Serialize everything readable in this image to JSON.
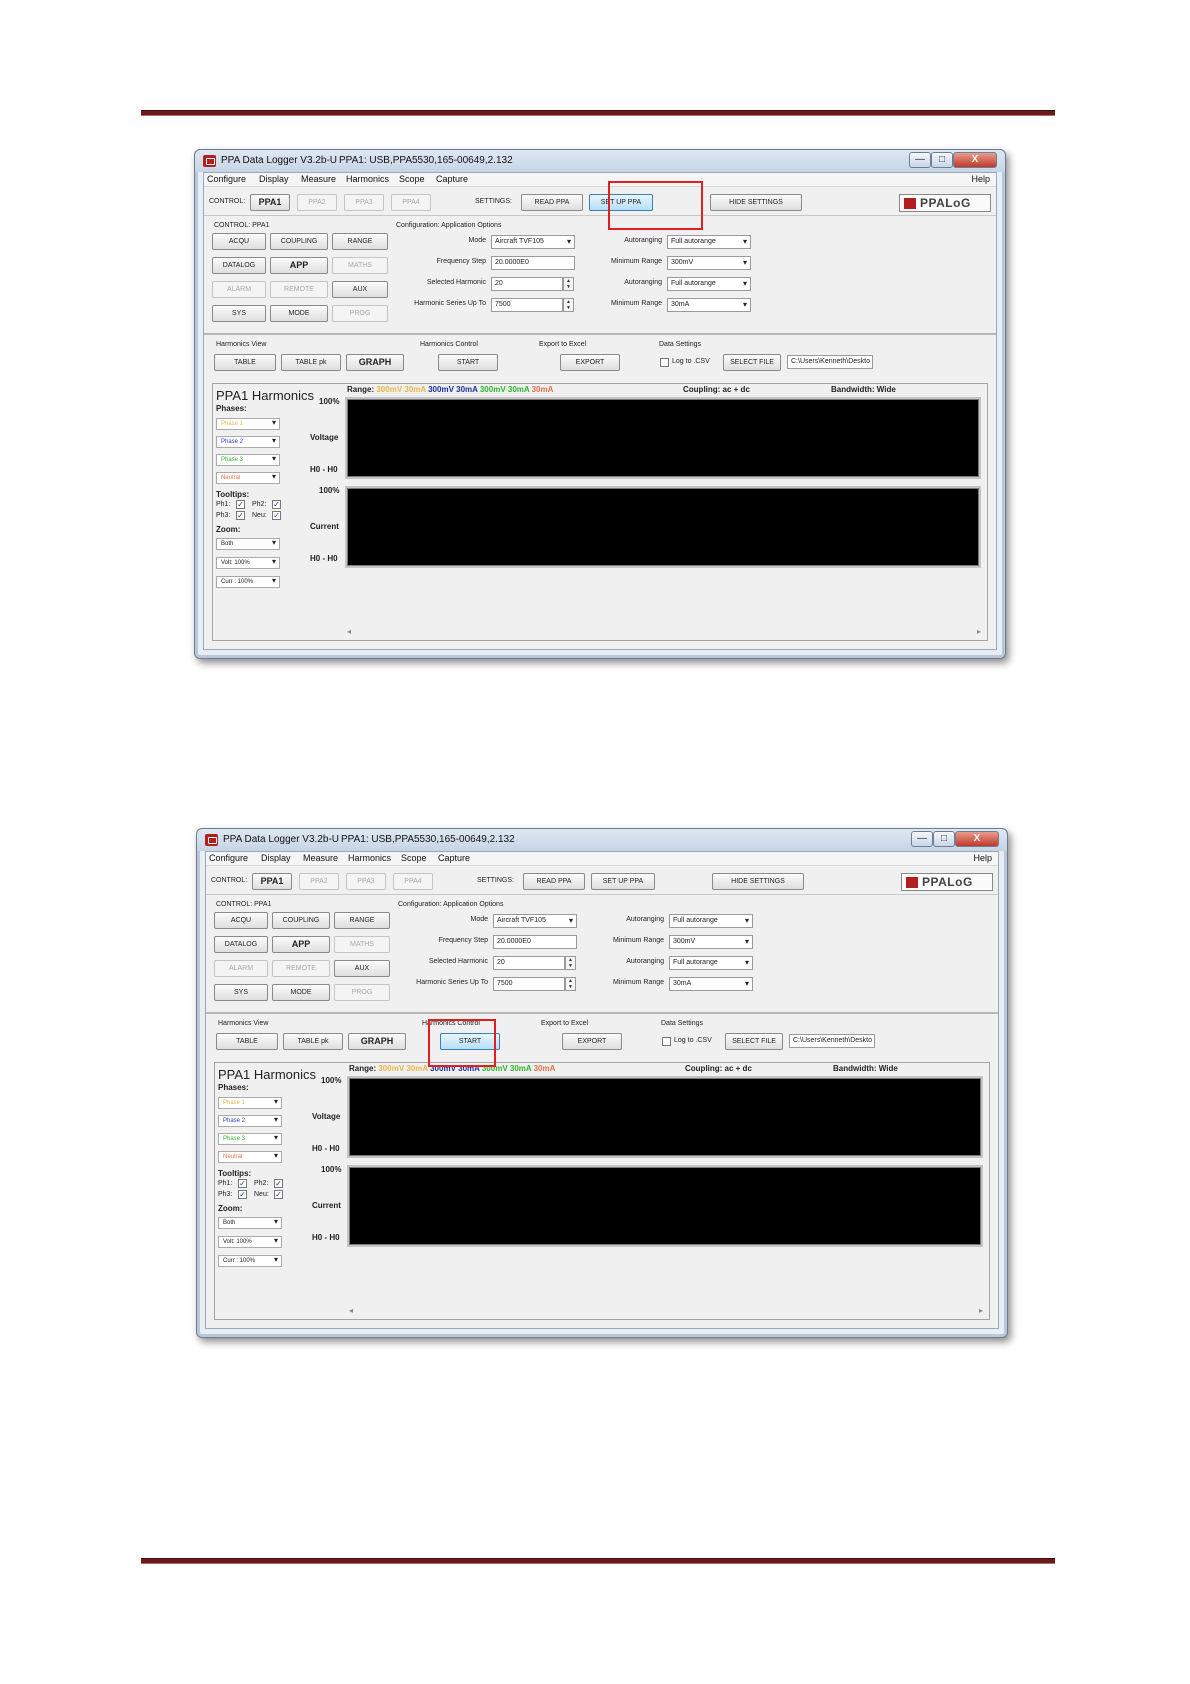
{
  "app": {
    "title": "PPA Data Logger V3.2b-U",
    "connection": "PPA1: USB,PPA5530,165-00649,2.132",
    "window_buttons": {
      "minimize": "—",
      "maximize": "□",
      "close": "X"
    }
  },
  "menu": [
    "Configure",
    "Display",
    "Measure",
    "Harmonics",
    "Scope",
    "Capture"
  ],
  "menu_help": "Help",
  "control_bar": {
    "control_label": "CONTROL:",
    "ppa_tabs": [
      "PPA1",
      "PPA2",
      "PPA3",
      "PPA4"
    ],
    "settings_label": "SETTINGS:",
    "read_ppa": "READ PPA",
    "set_up_ppa": "SET UP PPA",
    "hide_settings": "HIDE SETTINGS",
    "logo": "PPALoG"
  },
  "settings": {
    "control_title": "CONTROL: PPA1",
    "buttons": [
      "ACQU",
      "COUPLING",
      "RANGE",
      "DATALOG",
      "APP",
      "MATHS",
      "ALARM",
      "REMOTE",
      "AUX",
      "SYS",
      "MODE",
      "PROG"
    ],
    "config_title": "Configuration: Application Options",
    "fields": {
      "mode_label": "Mode",
      "mode_value": "Aircraft TVF105",
      "freq_label": "Frequency Step",
      "freq_value": "20.0000E0",
      "sel_label": "Selected Harmonic",
      "sel_value": "20",
      "series_label": "Harmonic Series Up To",
      "series_value": "7500",
      "auto1_label": "Autoranging",
      "auto1_value": "Full autorange",
      "min1_label": "Minimum Range",
      "min1_value": "300mV",
      "auto2_label": "Autoranging",
      "auto2_value": "Full autorange",
      "min2_label": "Minimum Range",
      "min2_value": "30mA"
    }
  },
  "toolbar": {
    "view_label": "Harmonics View",
    "table": "TABLE",
    "table_pk": "TABLE pk",
    "graph": "GRAPH",
    "control_label": "Harmonics Control",
    "start": "START",
    "excel_label": "Export to Excel",
    "export": "EXPORT",
    "data_label": "Data Settings",
    "log_csv": "Log to .CSV",
    "log_csv_checked": false,
    "select_file": "SELECT FILE",
    "file_path": "C:\\Users\\Kenneth\\Deskto"
  },
  "harmonics": {
    "title": "PPA1 Harmonics",
    "phases_label": "Phases:",
    "phases": [
      {
        "name": "Phase 1",
        "color": "#e8b84a"
      },
      {
        "name": "Phase 2",
        "color": "#2f3fc8"
      },
      {
        "name": "Phase 3",
        "color": "#2fb52f"
      },
      {
        "name": "Neutral",
        "color": "#e0704a"
      }
    ],
    "tooltips_label": "Tooltips:",
    "tooltips": {
      "ph1": "Ph1:",
      "ph2": "Ph2:",
      "ph3": "Ph3:",
      "neu": "Neu:"
    },
    "zoom_label": "Zoom:",
    "zoom_values": [
      "Both",
      "Volt: 100%",
      "Curr : 100%"
    ],
    "range_label": "Range:",
    "ranges": [
      {
        "text": "300mV 30mA",
        "color": "#e8b84a"
      },
      {
        "text": "300mV 30mA",
        "color": "#1c2f9e"
      },
      {
        "text": "300mV 30mA",
        "color": "#2fb52f"
      },
      {
        "text": "30mA",
        "color": "#e0704a"
      }
    ],
    "coupling": "Coupling: ac + dc",
    "bandwidth": "Bandwidth: Wide",
    "voltage": {
      "pct": "100%",
      "label": "Voltage",
      "h": "H0 - H0"
    },
    "current": {
      "pct": "100%",
      "label": "Current",
      "h": "H0 - H0"
    },
    "scroll_left": "◂",
    "scroll_right": "▸"
  }
}
